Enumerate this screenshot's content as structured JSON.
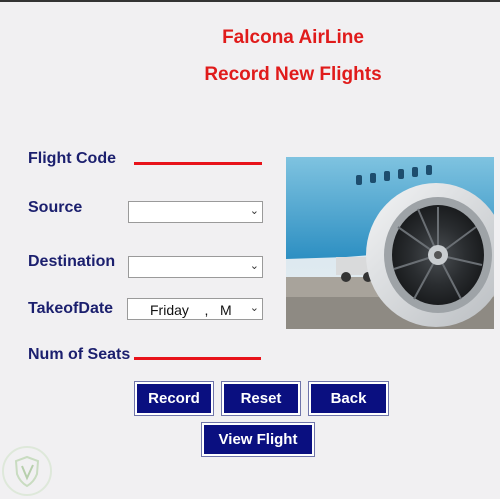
{
  "header": {
    "app_title": "Falcona AirLine",
    "page_title": "Record New Flights"
  },
  "form": {
    "flight_code_label": "Flight Code",
    "source_label": "Source",
    "source_value": "",
    "destination_label": "Destination",
    "destination_value": "",
    "takeoff_date_label": "TakeofDate",
    "takeoff_date_value": "Friday    ,   M",
    "num_seats_label": "Num of Seats"
  },
  "buttons": {
    "record": "Record",
    "reset": "Reset",
    "back": "Back",
    "view_flight": "View Flight"
  },
  "colors": {
    "title_red": "#e01b1b",
    "label_navy": "#1b1f6e",
    "button_navy": "#0a0f80",
    "underline_red": "#e8131a"
  },
  "icons": {
    "dropdown": "chevron-down-icon",
    "watermark": "shield-leaf-logo"
  }
}
